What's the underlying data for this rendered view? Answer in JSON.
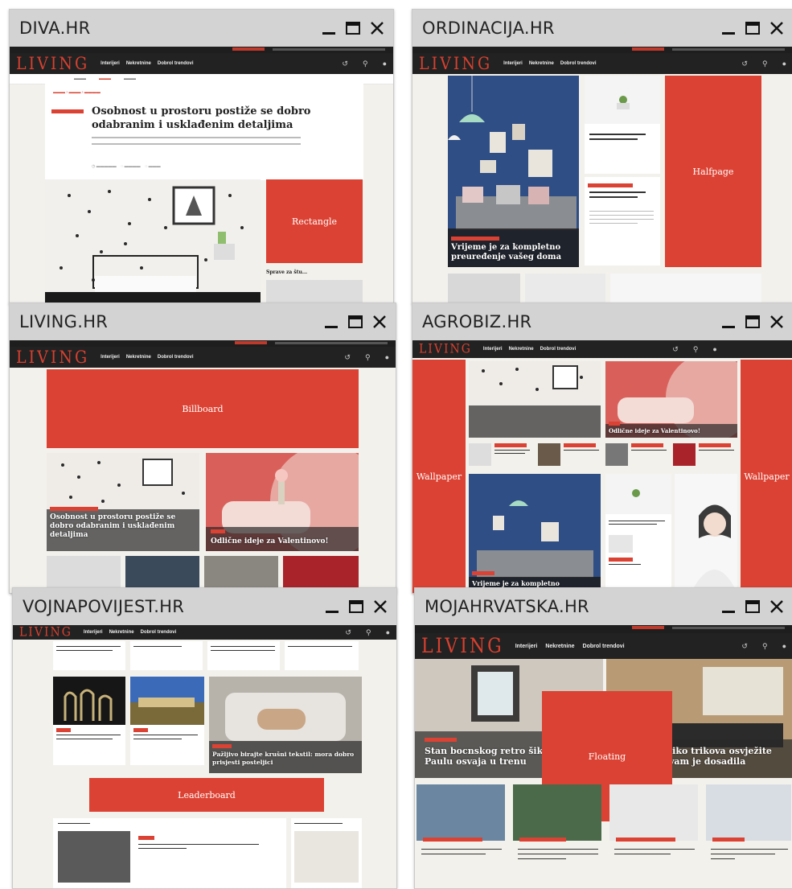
{
  "windows": [
    {
      "title": "DIVA.HR",
      "ad_label": "Rectangle",
      "headline": "Osobnost u prostoru postiže se dobro odabranim i usklađenim detaljima",
      "side_headline": "Sprave za štu..."
    },
    {
      "title": "ORDINACIJA.HR",
      "ad_label": "Halfpage",
      "caption": "Vrijeme je za kompletno preuređenje vašeg doma"
    },
    {
      "title": "LIVING.HR",
      "ad_label": "Billboard",
      "caption_left": "Osobnost u prostoru postiže se dobro odabranim i usklađenim detaljima",
      "caption_right": "Odlične ideje za Valentinovo!"
    },
    {
      "title": "AGROBIZ.HR",
      "ad_label_left": "Wallpaper",
      "ad_label_right": "Wallpaper",
      "caption_top": "Odlične ideje za Valentinovo!",
      "caption_bottom": "Vrijeme je za kompletno"
    },
    {
      "title": "VOJNAPOVIJEST.HR",
      "ad_label": "Leaderboard",
      "caption": "Pažljivo birajte krušni tekstil: mora dobro prisjesti posteljici"
    },
    {
      "title": "MOJAHRVATSKA.HR",
      "ad_label": "Floating",
      "caption_left": "Stan bocnskog retro šika Paulu osvaja u trenu",
      "caption_right": "liko trikova osvježite vam je dosadila"
    }
  ],
  "site": {
    "logo": "LIVING",
    "nav": [
      "Interijeri",
      "Nekretnine",
      "Dobrol trendovi"
    ]
  },
  "colors": {
    "accent": "#dc4233",
    "titlebar": "#d3d3d3",
    "navbar": "#222222",
    "page": "#f3f1ec"
  },
  "icons": [
    "minimize-icon",
    "maximize-icon",
    "close-icon",
    "search-icon",
    "user-icon"
  ]
}
